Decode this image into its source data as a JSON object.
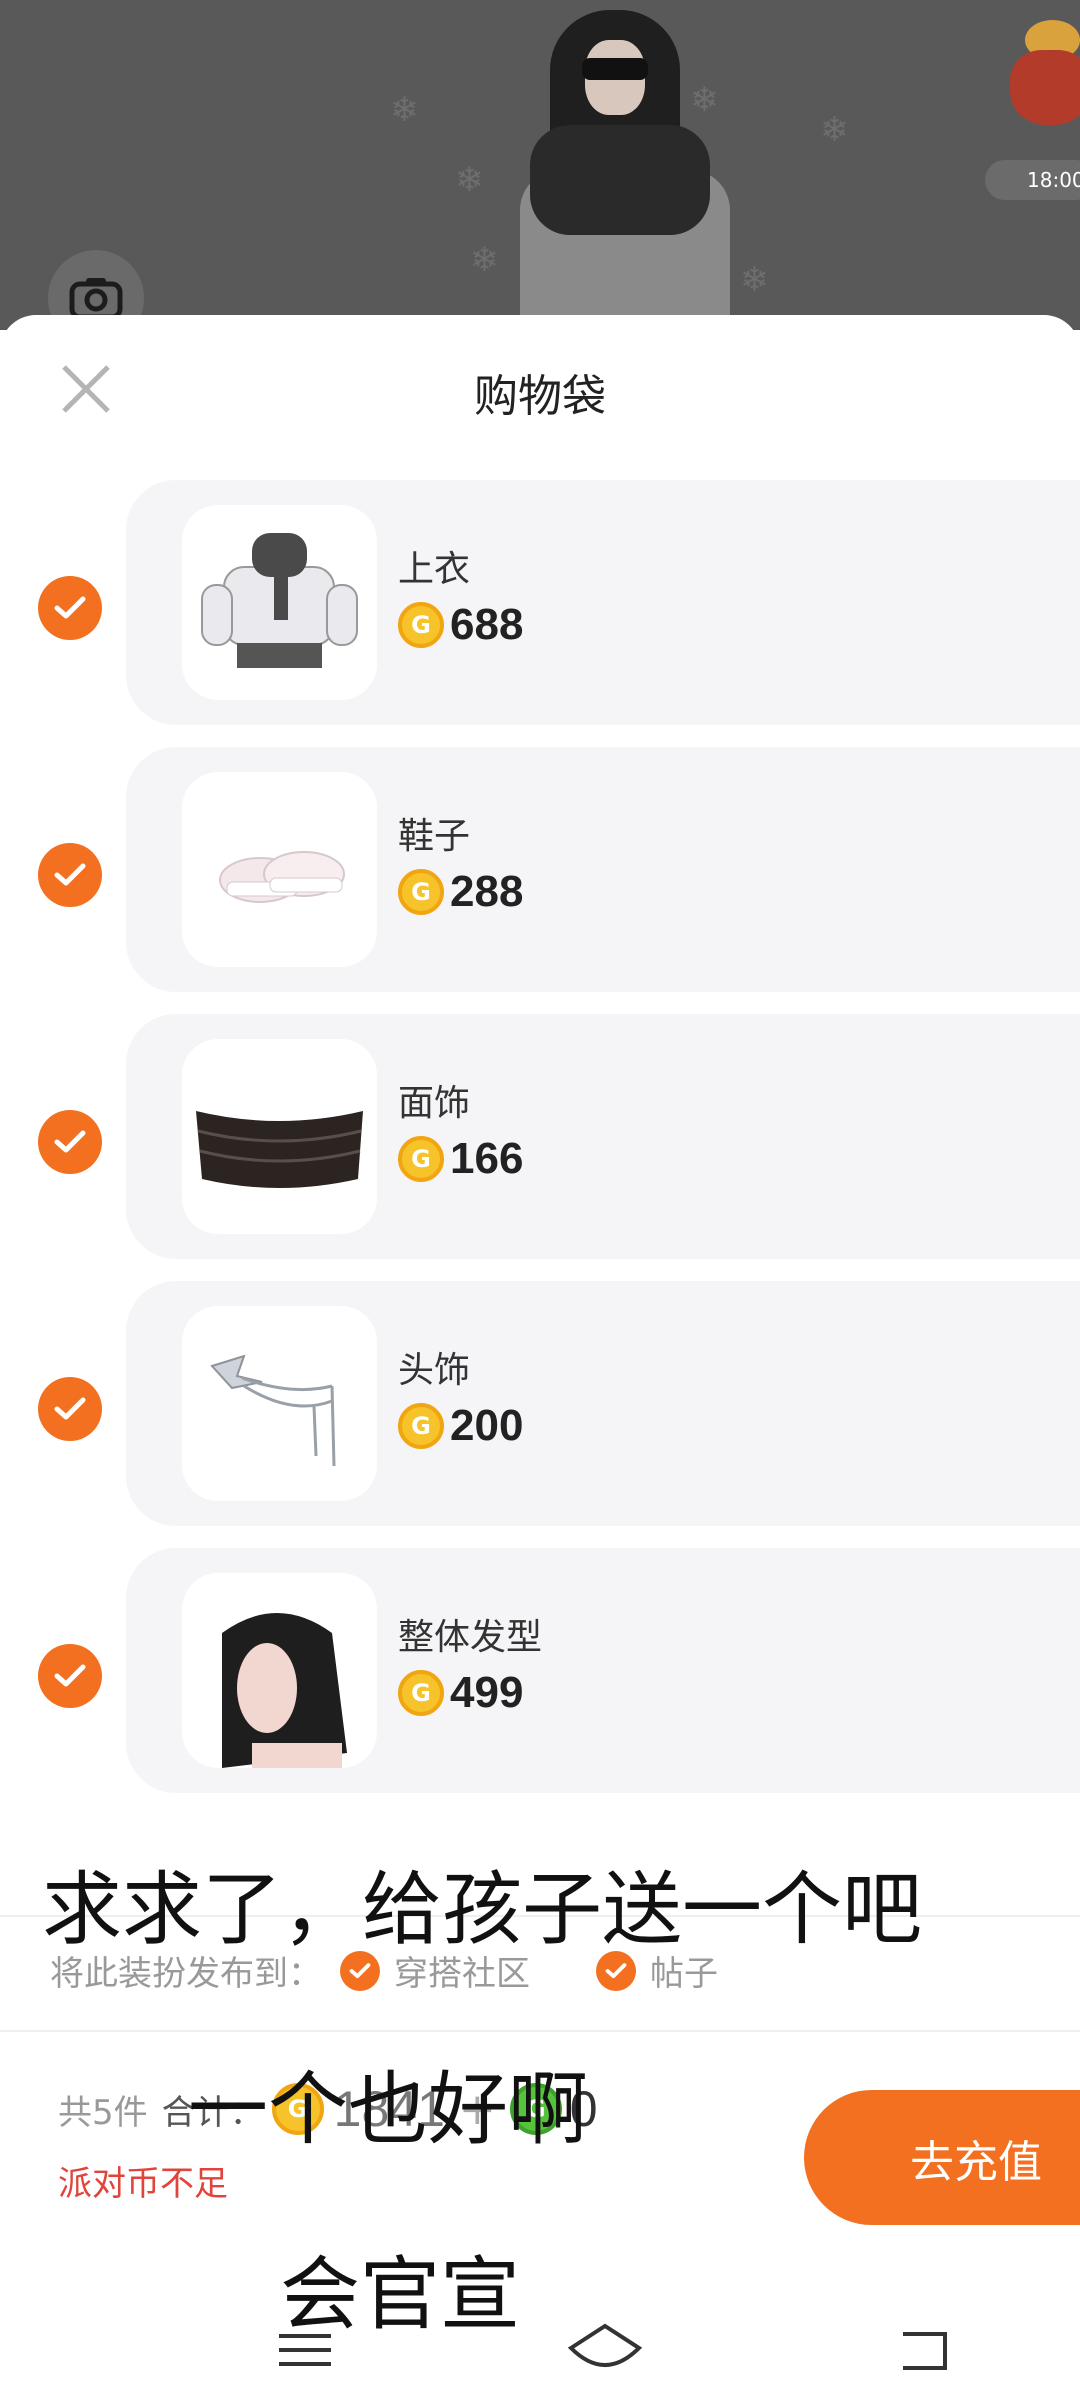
{
  "scene": {
    "gift_time": "18:00"
  },
  "sheet": {
    "title": "购物袋"
  },
  "items": [
    {
      "name": "上衣",
      "price": "688",
      "coin_icon": "gold-coin-icon"
    },
    {
      "name": "鞋子",
      "price": "288",
      "coin_icon": "gold-coin-icon"
    },
    {
      "name": "面饰",
      "price": "166",
      "coin_icon": "gold-coin-icon"
    },
    {
      "name": "头饰",
      "price": "200",
      "coin_icon": "gold-coin-icon"
    },
    {
      "name": "整体发型",
      "price": "499",
      "coin_icon": "gold-coin-icon"
    }
  ],
  "captions": {
    "line1": "求求了，给孩子送一个吧",
    "line2": "一个也好啊",
    "line3": "会官宣"
  },
  "publish": {
    "label": "将此装扮发布到：",
    "options": [
      "穿搭社区",
      "帖子"
    ]
  },
  "summary": {
    "count": "共5件",
    "total_label": "合计：",
    "total": "1841",
    "plus": "+",
    "green_total": "0",
    "warning": "派对币不足"
  },
  "actions": {
    "recharge": "去充值"
  },
  "colors": {
    "accent": "#f37021",
    "warning": "#e0443b",
    "coin_gold": "#f6c32b",
    "coin_green": "#56c43b"
  }
}
